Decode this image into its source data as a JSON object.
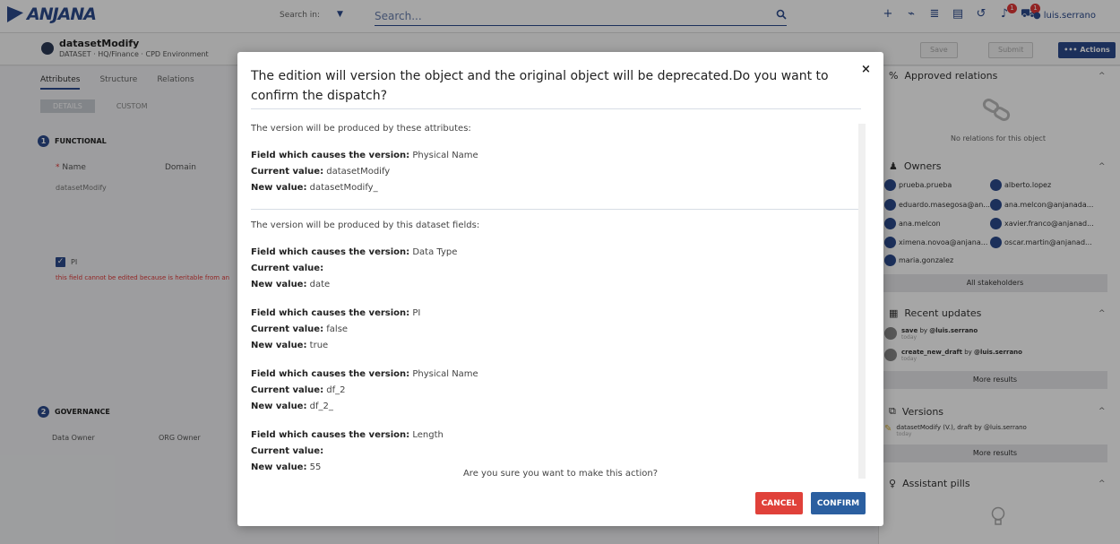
{
  "app": {
    "logo_text": "ANJANA"
  },
  "topbar": {
    "search_in_label": "Search in:",
    "search_placeholder": "Search...",
    "user": "luis.serrano",
    "badge_counts": [
      "1",
      "1"
    ]
  },
  "object": {
    "title": "datasetModify",
    "meta": "DATASET  ·  HQ/Finance  ·  CPD Environment",
    "save_label": "Save",
    "submit_label": "Submit",
    "actions_label": "••• Actions"
  },
  "left": {
    "tabs": [
      "Attributes",
      "Structure",
      "Relations"
    ],
    "subtabs": [
      "DETAILS",
      "CUSTOM"
    ],
    "functional": {
      "num": "1",
      "label": "FUNCTIONAL"
    },
    "name_label": "Name",
    "domain_label": "Domain",
    "name_value": "datasetModify",
    "pi_label": "PI",
    "pi_error": "this field cannot be edited because is heritable from an",
    "governance": {
      "num": "2",
      "label": "GOVERNANCE"
    },
    "data_owner_label": "Data Owner",
    "org_owner_label": "ORG Owner"
  },
  "right": {
    "approved_relations": "Approved relations",
    "no_relations": "No relations for this object",
    "owners_title": "Owners",
    "owners": [
      "prueba.prueba",
      "alberto.lopez",
      "eduardo.masegosa@an...",
      "ana.melcon@anjanada...",
      "ana.melcon",
      "xavier.franco@anjanad...",
      "ximena.novoa@anjana...",
      "oscar.martin@anjanad...",
      "maria.gonzalez"
    ],
    "all_stakeholders": "All stakeholders",
    "recent_updates_title": "Recent updates",
    "updates": [
      {
        "action": "save",
        "by": "by",
        "user": "@luis.serrano",
        "when": "today"
      },
      {
        "action": "create_new_draft",
        "by": "by",
        "user": "@luis.serrano",
        "when": "today"
      }
    ],
    "more_results": "More results",
    "versions_title": "Versions",
    "version_item": "datasetModify (V.), draft by @luis.serrano",
    "version_when": "today",
    "assistant_title": "Assistant pills"
  },
  "modal": {
    "title": "The edition will version the object and the original object will be deprecated.Do you want to confirm the dispatch?",
    "close": "×",
    "intro_attributes": "The version will be produced by these attributes:",
    "attributes": [
      {
        "field_label": "Field which causes the version:",
        "field": "Physical Name",
        "current_label": "Current value:",
        "current": "datasetModify",
        "new_label": "New value:",
        "new": "datasetModify_"
      }
    ],
    "intro_fields": "The version will be produced by this dataset fields:",
    "fields": [
      {
        "field_label": "Field which causes the version:",
        "field": "Data Type",
        "current_label": "Current value:",
        "current": "",
        "new_label": "New value:",
        "new": "date"
      },
      {
        "field_label": "Field which causes the version:",
        "field": "PI",
        "current_label": "Current value:",
        "current": "false",
        "new_label": "New value:",
        "new": "true"
      },
      {
        "field_label": "Field which causes the version:",
        "field": "Physical Name",
        "current_label": "Current value:",
        "current": "df_2",
        "new_label": "New value:",
        "new": "df_2_"
      },
      {
        "field_label": "Field which causes the version:",
        "field": "Length",
        "current_label": "Current value:",
        "current": "",
        "new_label": "New value:",
        "new": "55"
      }
    ],
    "question": "Are you sure you want to make this action?",
    "cancel_label": "CANCEL",
    "confirm_label": "CONFIRM"
  }
}
